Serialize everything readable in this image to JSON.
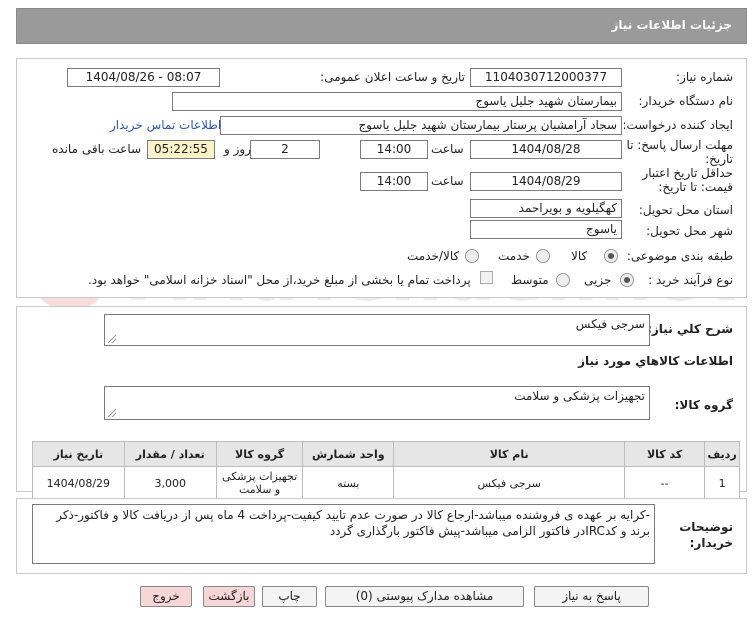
{
  "header": {
    "title": "جزئیات اطلاعات نیاز"
  },
  "form": {
    "need_number_label": "شماره نیاز:",
    "need_number": "1104030712000377",
    "announce_label": "تاریخ و ساعت اعلان عمومی:",
    "announce_value": "1404/08/26 - 08:07",
    "buyer_label": "نام دستگاه خریدار:",
    "buyer_value": "بیمارستان شهید جلیل یاسوج",
    "creator_label": "ایجاد کننده درخواست:",
    "creator_value": "سجاد آرامشیان پرستار بیمارستان شهید جلیل یاسوج",
    "contact_link": "اطلاعات تماس خریدار",
    "deadline_label_1": "مهلت ارسال پاسخ: تا",
    "deadline_label_2": "تاریخ:",
    "deadline_date": "1404/08/28",
    "time_label": "ساعت",
    "deadline_time": "14:00",
    "days_value": "2",
    "days_label": "روز و",
    "remaining_time": "05:22:55",
    "remaining_label": "ساعت باقی مانده",
    "validity_label_1": "حداقل تاریخ اعتبار",
    "validity_label_2": "قیمت: تا تاریخ:",
    "validity_date": "1404/08/29",
    "validity_time_label": "ساعت",
    "validity_time": "14:00",
    "province_label": "استان محل تحویل:",
    "province_value": "کهگیلویه و بویراحمد",
    "city_label": "شهر محل تحویل:",
    "city_value": "یاسوج",
    "category_label": "طبقه بندی موضوعی:",
    "category_options": [
      "کالا",
      "خدمت",
      "کالا/خدمت"
    ],
    "category_selected": "کالا",
    "process_label": "نوع فرآیند خرید :",
    "process_options": [
      "جزیی",
      "متوسط"
    ],
    "process_selected": "جزیی",
    "payment_note": "پرداخت تمام یا بخشی از مبلغ خرید،از محل \"اسناد خزانه اسلامی\" خواهد بود."
  },
  "general": {
    "desc_label": "شرح کلي نياز:",
    "desc_value": "سرجی فیکس",
    "goods_info_title": "اطلاعات کالاهاي مورد نياز",
    "group_label": "گروه کالا:",
    "group_value": "تجهیزات پزشکی و سلامت"
  },
  "table": {
    "headers": [
      "ردیف",
      "کد کالا",
      "نام کالا",
      "واحد شمارش",
      "گروه کالا",
      "تعداد / مقدار",
      "تاریخ نیاز"
    ],
    "rows": [
      [
        "1",
        "--",
        "سرجی فیکس",
        "بسته",
        "تجهیزات پزشکی و سلامت",
        "3,000",
        "1404/08/29"
      ]
    ]
  },
  "notes": {
    "label_1": "توضیحات",
    "label_2": "خریدار:",
    "text": "-کرایه بر عهده ی فروشنده میباشد-ارجاع کالا در صورت عدم تایید کیفیت-پرداخت 4 ماه پس از دریافت کالا و فاکتور-ذکر برند و کدIRCدر فاکتور الزامی میباشد-پیش فاکتور بارگذاری گردد"
  },
  "buttons": {
    "reply": "پاسخ به نیاز",
    "attachments": "مشاهده مدارک پیوستی (0)",
    "print": "چاپ",
    "back": "بازگشت",
    "exit": "خروج"
  },
  "watermark_text": "AriaTender.net"
}
